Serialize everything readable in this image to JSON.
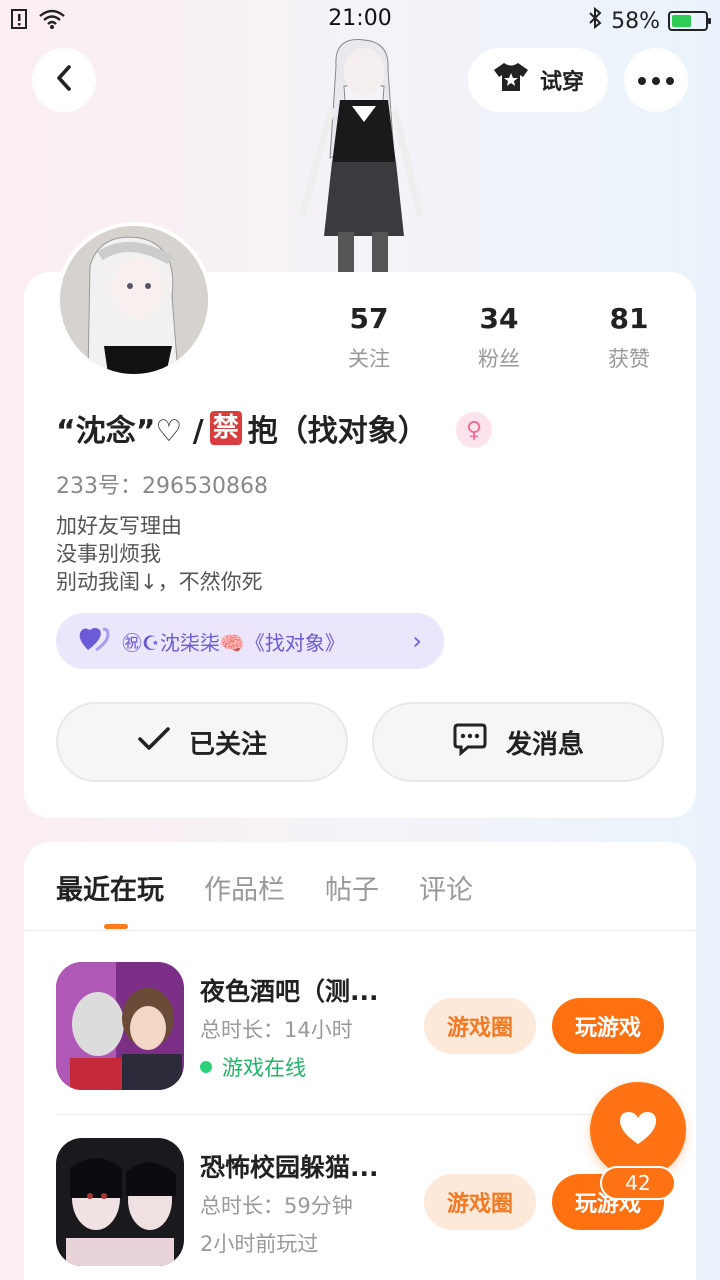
{
  "status_bar": {
    "time": "21:00",
    "battery_pct": "58%",
    "battery_level": 0.58,
    "icons": [
      "notification-icon",
      "wifi-icon",
      "bluetooth-icon",
      "battery-icon"
    ]
  },
  "header": {
    "tryon_label": "试穿"
  },
  "profile": {
    "stats": [
      {
        "num": "57",
        "label": "关注"
      },
      {
        "num": "34",
        "label": "粉丝"
      },
      {
        "num": "81",
        "label": "获赞"
      }
    ],
    "nickname_pre": "“沈念”♡ / ",
    "nickname_ban": "禁",
    "nickname_post": "抱（找对象）",
    "gender_symbol": "♀",
    "uid": "233号：296530868",
    "bio": [
      "加好友写理由",
      "没事别烦我",
      "别动我闺↓，不然你死"
    ],
    "group_label": "㊗☪沈柒柒🧠《找对象》",
    "follow_label": "已关注",
    "message_label": "发消息"
  },
  "tabs": [
    {
      "label": "最近在玩",
      "active": true
    },
    {
      "label": "作品栏",
      "active": false
    },
    {
      "label": "帖子",
      "active": false
    },
    {
      "label": "评论",
      "active": false
    }
  ],
  "games": [
    {
      "title": "夜色酒吧（测...",
      "duration": "总时长：14小时",
      "status": "游戏在线",
      "circle_label": "游戏圈",
      "play_label": "玩游戏"
    },
    {
      "title": "恐怖校园躲猫...",
      "duration": "总时长：59分钟",
      "status": "2小时前玩过",
      "circle_label": "游戏圈",
      "play_label": "玩游戏"
    }
  ],
  "like_count": "42",
  "colors": {
    "accent": "#ff7011",
    "online": "#21b56a",
    "group_pill": "#ebe6fb"
  }
}
